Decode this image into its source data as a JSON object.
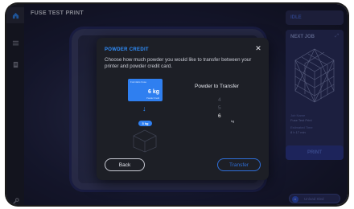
{
  "header": {
    "title": "FUSE TEST PRINT"
  },
  "sidebar": {
    "items": [
      {
        "icon": "home-icon"
      },
      {
        "icon": "list-icon"
      },
      {
        "icon": "files-icon"
      },
      {
        "icon": "wrench-icon"
      }
    ]
  },
  "status": {
    "label": "IDLE"
  },
  "next_job": {
    "title": "NEXT JOB",
    "job_name_label": "Job Name",
    "job_name": "Fuse Test Print",
    "time_label": "Estimated Time",
    "time": "8 h 17 min",
    "print_label": "PRINT"
  },
  "unload": {
    "label": "Unload Sled"
  },
  "dialog": {
    "title": "POWDER CREDIT",
    "description": "Choose how much powder you would like to transfer between your printer and powder credit card.",
    "card_brand": "Formlabs Fuse",
    "card_amount": "6 kg",
    "card_sub": "Powder Credit",
    "transfer_pill": "3 kg",
    "powder_label": "Powder to Transfer",
    "picker_values": [
      "4",
      "5",
      "6"
    ],
    "picker_selected": "6",
    "picker_unit": "kg",
    "back_label": "Back",
    "transfer_label": "Transfer"
  },
  "colors": {
    "accent": "#2f8fff",
    "dialog_bg": "#1d1f26",
    "card_blue": "#2f7ff0"
  }
}
